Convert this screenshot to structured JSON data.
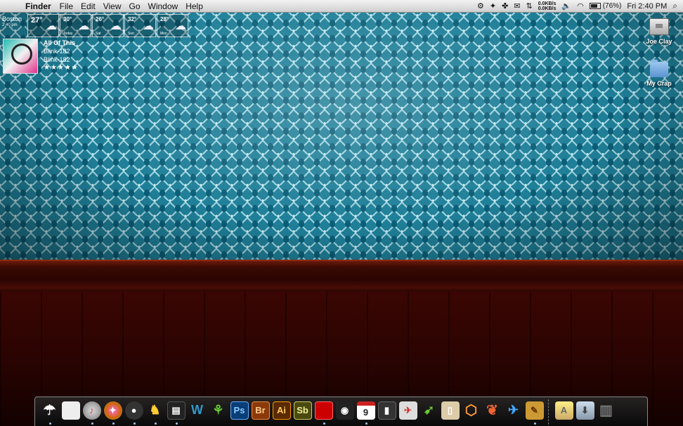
{
  "menubar": {
    "app": "Finder",
    "menus": [
      "File",
      "Edit",
      "View",
      "Go",
      "Window",
      "Help"
    ],
    "net_up": "0.0KB/s",
    "net_down": "0.0KB/s",
    "battery": "(76%)",
    "battery_level": 0.76,
    "clock": "Fri 2:40 PM"
  },
  "weather": {
    "city": "Boston",
    "time": "2:40 pm",
    "current_temp": "27°",
    "forecast": [
      {
        "temp": "30°",
        "day": "Today"
      },
      {
        "temp": "26°",
        "day": "Sat"
      },
      {
        "temp": "32°",
        "day": "Sun"
      },
      {
        "temp": "28°",
        "day": "Mon"
      }
    ]
  },
  "now_playing": {
    "track": "All Of This",
    "artist": "Blink-182",
    "album": "Blink-182",
    "rating": "★★★★★"
  },
  "desktop_icons": [
    {
      "label": "Joe Clay"
    },
    {
      "label": "My Crap"
    }
  ],
  "dock": {
    "ps": "Ps",
    "br": "Br",
    "ai": "Ai",
    "sb": "Sb",
    "cal": "9"
  },
  "colors": {
    "wallpaper": "#1f7f98",
    "floor": "#2a0402",
    "menubar": "#e4e4e4"
  }
}
